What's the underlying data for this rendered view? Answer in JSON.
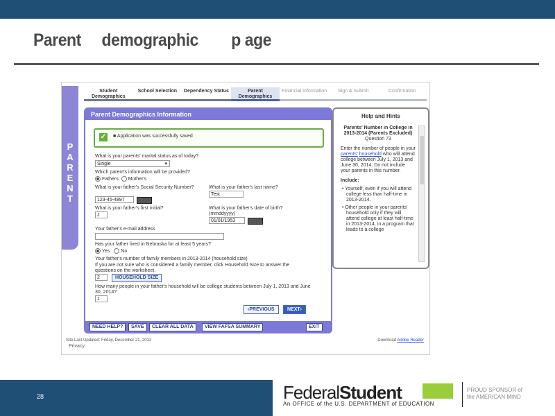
{
  "slide": {
    "title": "Parent     demographic        p age",
    "page_number": "28"
  },
  "sidebar": {
    "letters": [
      "P",
      "A",
      "R",
      "E",
      "N",
      "T"
    ]
  },
  "steps": [
    {
      "label": "Student Demographics",
      "state": "done"
    },
    {
      "label": "School Selection",
      "state": "done"
    },
    {
      "label": "Dependency Status",
      "state": "done"
    },
    {
      "label": "Parent Demographics",
      "state": "active"
    },
    {
      "label": "Financial Information",
      "state": "future"
    },
    {
      "label": "Sign & Submit",
      "state": "future"
    },
    {
      "label": "Confirmation",
      "state": "future"
    }
  ],
  "panel": {
    "title": "Parent Demographics Information",
    "success_msg": "Application was successfully saved"
  },
  "form": {
    "marital_q": "What is your parents' marital status as of today?",
    "marital_val": "Single",
    "which_q": "Which parent's information will be provided?",
    "opt_fathers": "Fathers",
    "opt_mothers": "Mother's",
    "ssn_q": "What is your father's Social Security Number?",
    "ssn_val": "123-45-4897",
    "last_q": "What is your father's last name?",
    "last_val": "Test",
    "initial_q": "What is your father's first initial?",
    "initial_val": "J",
    "dob_q": "What is your father's date of birth? (mmddyyyy)",
    "dob_val": "01/01/1953",
    "email_q": "Your father's e-mail address",
    "lived_q": "Has your father lived in Nebraska for at least 5 years?",
    "yes": "Yes",
    "no": "No",
    "family_q": "Your father's number of family members in 2013-2014 (household size)",
    "family_note": "If you are not sure who is considered a family member, click Household Size to answer the questions on the worksheet.",
    "family_val": "2",
    "household_btn": "HOUSEHOLD SIZE",
    "college_q": "How many people in your father's household will be college students between July 1, 2013 and June 30, 2014?",
    "college_val": "1",
    "prev_btn": "PREVIOUS",
    "next_btn": "NEXT"
  },
  "bottom_bar": {
    "need_help": "NEED HELP?",
    "save": "SAVE",
    "clear": "CLEAR ALL DATA",
    "view": "VIEW FAFSA SUMMARY",
    "exit": "EXIT"
  },
  "help": {
    "title": "Help and Hints",
    "subtitle": "Parents' Number in College in 2013-2014 (Parents Excluded)",
    "question": "Question 73",
    "body_1": "Enter the number of people in your ",
    "body_link1": "parents'",
    "body_link2": "household",
    "body_2": " who will attend college between July 1, 2013 and June 30, 2014. Do not include your parents in this number.",
    "include": "Include:",
    "bullet1": "Yourself, even if you will attend college less than half-time in 2013-2014.",
    "bullet2": "Other people in your parents' household only if they will attend college at least half-time in 2013-2014, in a program that leads to a college"
  },
  "footer": {
    "updated": "Site Last Updated: Friday, December 21, 2012",
    "privacy": "Privacy",
    "download": "Download",
    "adobe": "Adobe Reader"
  },
  "logo": {
    "federal": "Federal",
    "student": "Student",
    "sub": "An OFFICE of the U.S. DEPARTMENT of EDUCATION",
    "tag1": "PROUD SPONSOR of",
    "tag2": "the AMERICAN MIND"
  },
  "colors": {
    "accent": "#7c79d8",
    "topbar": "#1f4f74",
    "success": "#63b13a"
  }
}
